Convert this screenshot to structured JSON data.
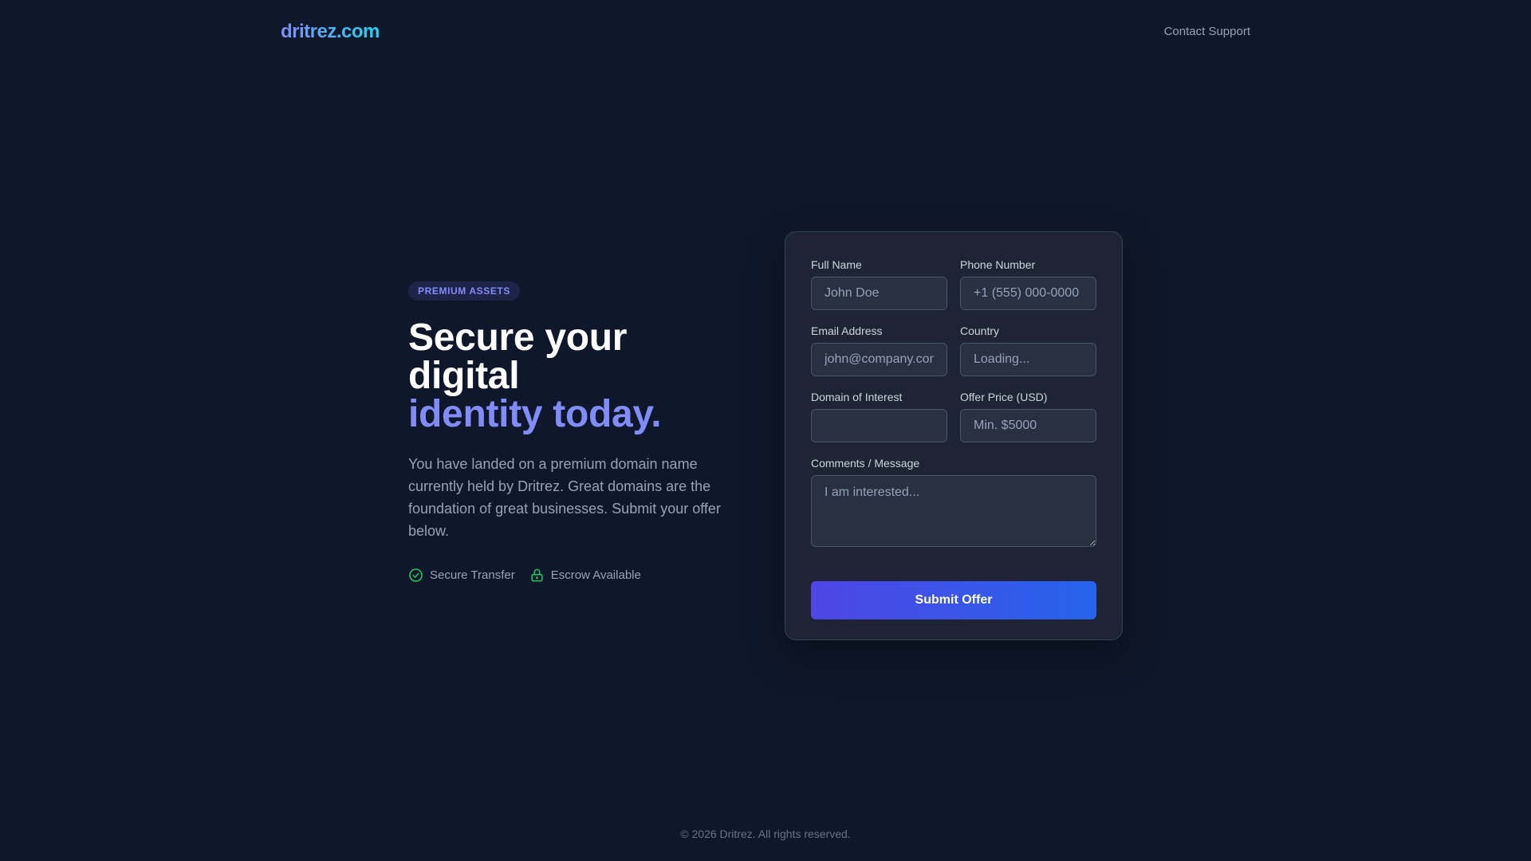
{
  "header": {
    "logo": "dritrez.com",
    "support_link": "Contact Support"
  },
  "hero": {
    "badge": "PREMIUM ASSETS",
    "headline_line1": "Secure your",
    "headline_line2": "digital",
    "headline_accent": "identity today.",
    "description": "You have landed on a premium domain name currently held by Dritrez. Great domains are the foundation of great businesses. Submit your offer below.",
    "features": [
      {
        "label": "Secure Transfer",
        "icon": "check-circle-icon"
      },
      {
        "label": "Escrow Available",
        "icon": "lock-icon"
      }
    ]
  },
  "form": {
    "full_name": {
      "label": "Full Name",
      "placeholder": "John Doe",
      "value": ""
    },
    "phone": {
      "label": "Phone Number",
      "placeholder": "+1 (555) 000-0000",
      "value": ""
    },
    "email": {
      "label": "Email Address",
      "placeholder": "john@company.com",
      "value": ""
    },
    "country": {
      "label": "Country",
      "placeholder": "Loading...",
      "value": ""
    },
    "domain": {
      "label": "Domain of Interest",
      "placeholder": "",
      "value": ""
    },
    "offer": {
      "label": "Offer Price (USD)",
      "placeholder": "Min. $5000",
      "value": ""
    },
    "comments": {
      "label": "Comments / Message",
      "placeholder": "I am interested...",
      "value": ""
    },
    "submit_label": "Submit Offer"
  },
  "footer": {
    "copyright": "© 2026 Dritrez. All rights reserved."
  },
  "colors": {
    "background": "#0f172a",
    "card": "#1e2433",
    "accent": "#818cf8",
    "feature_icon": "#22c55e",
    "button_start": "#4f46e5",
    "button_end": "#2563eb"
  }
}
